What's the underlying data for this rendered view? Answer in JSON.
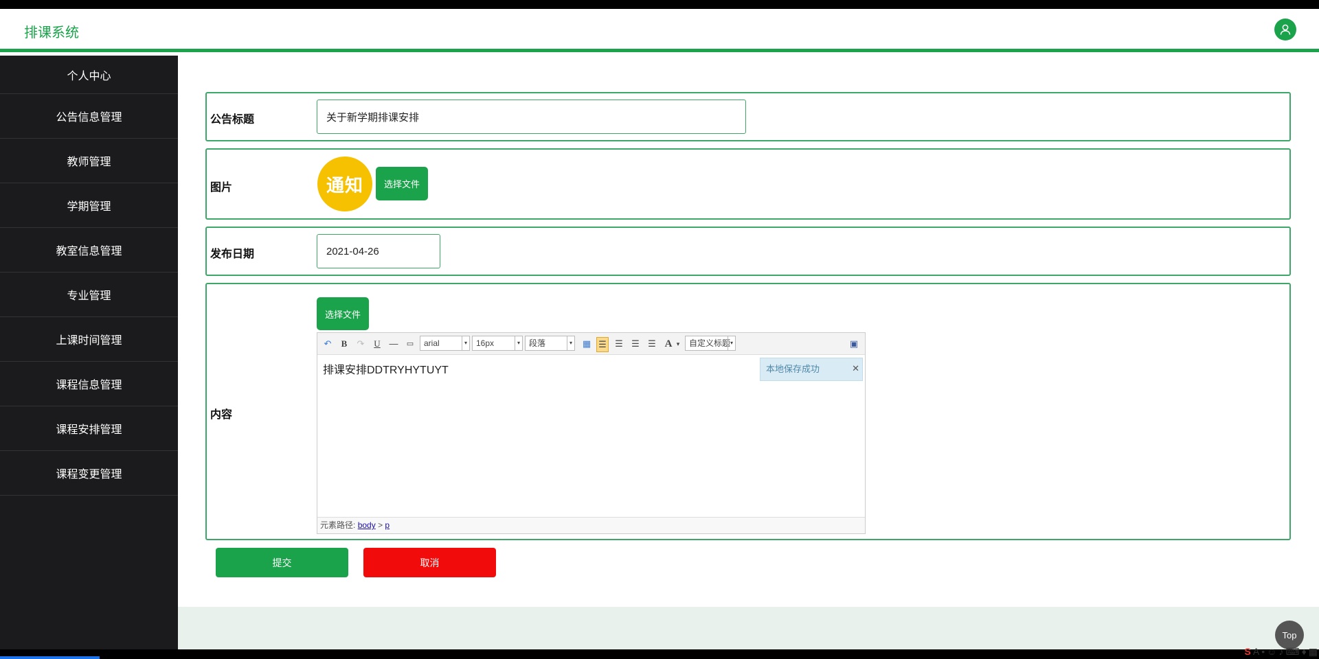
{
  "app": {
    "title": "排课系统"
  },
  "sidebar": {
    "items": [
      {
        "label": "个人中心"
      },
      {
        "label": "公告信息管理"
      },
      {
        "label": "教师管理"
      },
      {
        "label": "学期管理"
      },
      {
        "label": "教室信息管理"
      },
      {
        "label": "专业管理"
      },
      {
        "label": "上课时间管理"
      },
      {
        "label": "课程信息管理"
      },
      {
        "label": "课程安排管理"
      },
      {
        "label": "课程变更管理"
      }
    ]
  },
  "form": {
    "title_label": "公告标题",
    "title_value": "关于新学期排课安排",
    "image_label": "图片",
    "image_text": "通知",
    "choose_file": "选择文件",
    "date_label": "发布日期",
    "date_value": "2021-04-26",
    "content_label": "内容",
    "content_choose_file": "选择文件",
    "submit": "提交",
    "cancel": "取消"
  },
  "editor": {
    "font_family": "arial",
    "font_size": "16px",
    "paragraph": "段落",
    "custom_title": "自定义标题",
    "content_text": "排课安排DDTRYHYTUYT",
    "saved_tip": "本地保存成功",
    "path_label": "元素路径:",
    "path_body": "body",
    "path_sep": ">",
    "path_p": "p"
  },
  "top_button": "Top",
  "colors": {
    "accent": "#1aa34a",
    "cancel": "#f20b0b",
    "sidebar": "#1b1b1d"
  }
}
